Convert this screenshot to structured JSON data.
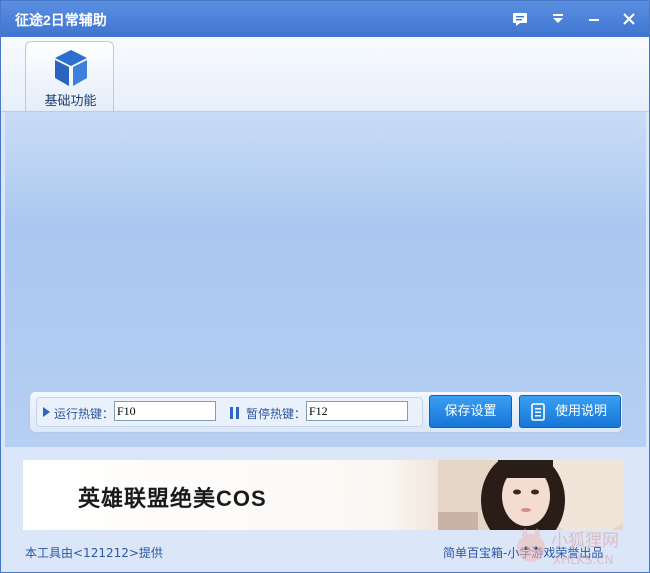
{
  "window": {
    "title": "征途2日常辅助"
  },
  "titlebar": {
    "buttons": [
      {
        "name": "feedback",
        "icon": "speech-bubble-icon",
        "glyph": "💬"
      },
      {
        "name": "menu",
        "icon": "dropdown-menu-icon",
        "glyph": "▾"
      },
      {
        "name": "minimize",
        "icon": "minimize-icon",
        "glyph": "—"
      },
      {
        "name": "close",
        "icon": "close-icon",
        "glyph": "✕"
      }
    ]
  },
  "tabs": [
    {
      "label": "基础功能",
      "icon": "cube-icon",
      "selected": true
    }
  ],
  "hotkeys": {
    "run_label": "运行热键：",
    "run_value": "F10",
    "pause_label": "暂停热键：",
    "pause_value": "F12"
  },
  "buttons": {
    "save": "保存设置",
    "help": "使用说明"
  },
  "banner": {
    "text": "英雄联盟绝美COS"
  },
  "footer": {
    "left": "本工具由<121212>提供",
    "right": "简单百宝箱-小学游戏荣誉出品"
  },
  "watermark": {
    "line1": "小狐狸网",
    "line2": "XHLKS.CN"
  },
  "colors": {
    "accent": "#3f75d2",
    "button": "#1675d6",
    "link": "#2b57a8"
  }
}
